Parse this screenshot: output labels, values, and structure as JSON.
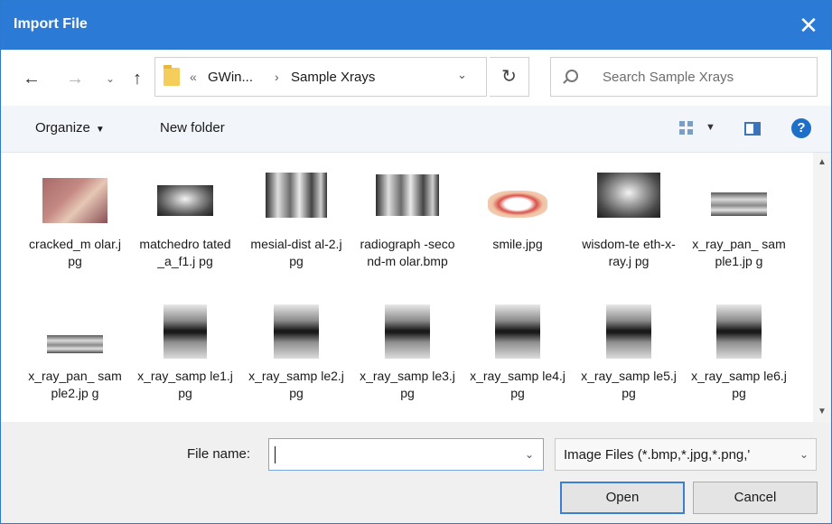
{
  "window": {
    "title": "Import File",
    "close_symbol": "✕"
  },
  "nav": {
    "back_symbol": "←",
    "forward_symbol": "→",
    "recent_symbol": "⌄",
    "up_symbol": "↑",
    "address": {
      "chevrons": "«",
      "crumb1": "GWin...",
      "separator": "›",
      "crumb2": "Sample Xrays",
      "dropdown_symbol": "⌄"
    },
    "refresh_symbol": "↻",
    "search_placeholder": "Search Sample Xrays"
  },
  "toolbar": {
    "organize_label": "Organize",
    "organize_caret": "▼",
    "new_folder_label": "New folder",
    "view_caret": "▼",
    "help_symbol": "?"
  },
  "files": [
    {
      "name": "cracked_m olar.jpg",
      "icon": "photo-thumbnail"
    },
    {
      "name": "matchedro tated_a_f1.j pg",
      "icon": "xray-thumbnail"
    },
    {
      "name": "mesial-dist al-2.jpg",
      "icon": "xray-thumbnail"
    },
    {
      "name": "radiograph -second-m olar.bmp",
      "icon": "xray-thumbnail"
    },
    {
      "name": "smile.jpg",
      "icon": "photo-thumbnail"
    },
    {
      "name": "wisdom-te eth-x-ray.j pg",
      "icon": "xray-thumbnail"
    },
    {
      "name": "x_ray_pan_ sample1.jp g",
      "icon": "xray-thumbnail"
    },
    {
      "name": "x_ray_pan_ sample2.jp g",
      "icon": "xray-thumbnail"
    },
    {
      "name": "x_ray_samp le1.jpg",
      "icon": "xray-thumbnail"
    },
    {
      "name": "x_ray_samp le2.jpg",
      "icon": "xray-thumbnail"
    },
    {
      "name": "x_ray_samp le3.jpg",
      "icon": "xray-thumbnail"
    },
    {
      "name": "x_ray_samp le4.jpg",
      "icon": "xray-thumbnail"
    },
    {
      "name": "x_ray_samp le5.jpg",
      "icon": "xray-thumbnail"
    },
    {
      "name": "x_ray_samp le6.jpg",
      "icon": "xray-thumbnail"
    }
  ],
  "scroll": {
    "up_symbol": "▲",
    "down_symbol": "▼"
  },
  "bottom": {
    "file_name_label": "File name:",
    "file_name_value": "",
    "file_name_dropdown": "⌄",
    "filter_value": "Image Files (*.bmp,*.jpg,*.png,'",
    "filter_dropdown": "⌄",
    "open_label": "Open",
    "cancel_label": "Cancel"
  },
  "colors": {
    "titlebar": "#2b7ad6",
    "accent": "#1e6fc8",
    "focus_border": "#3b7ed2"
  }
}
